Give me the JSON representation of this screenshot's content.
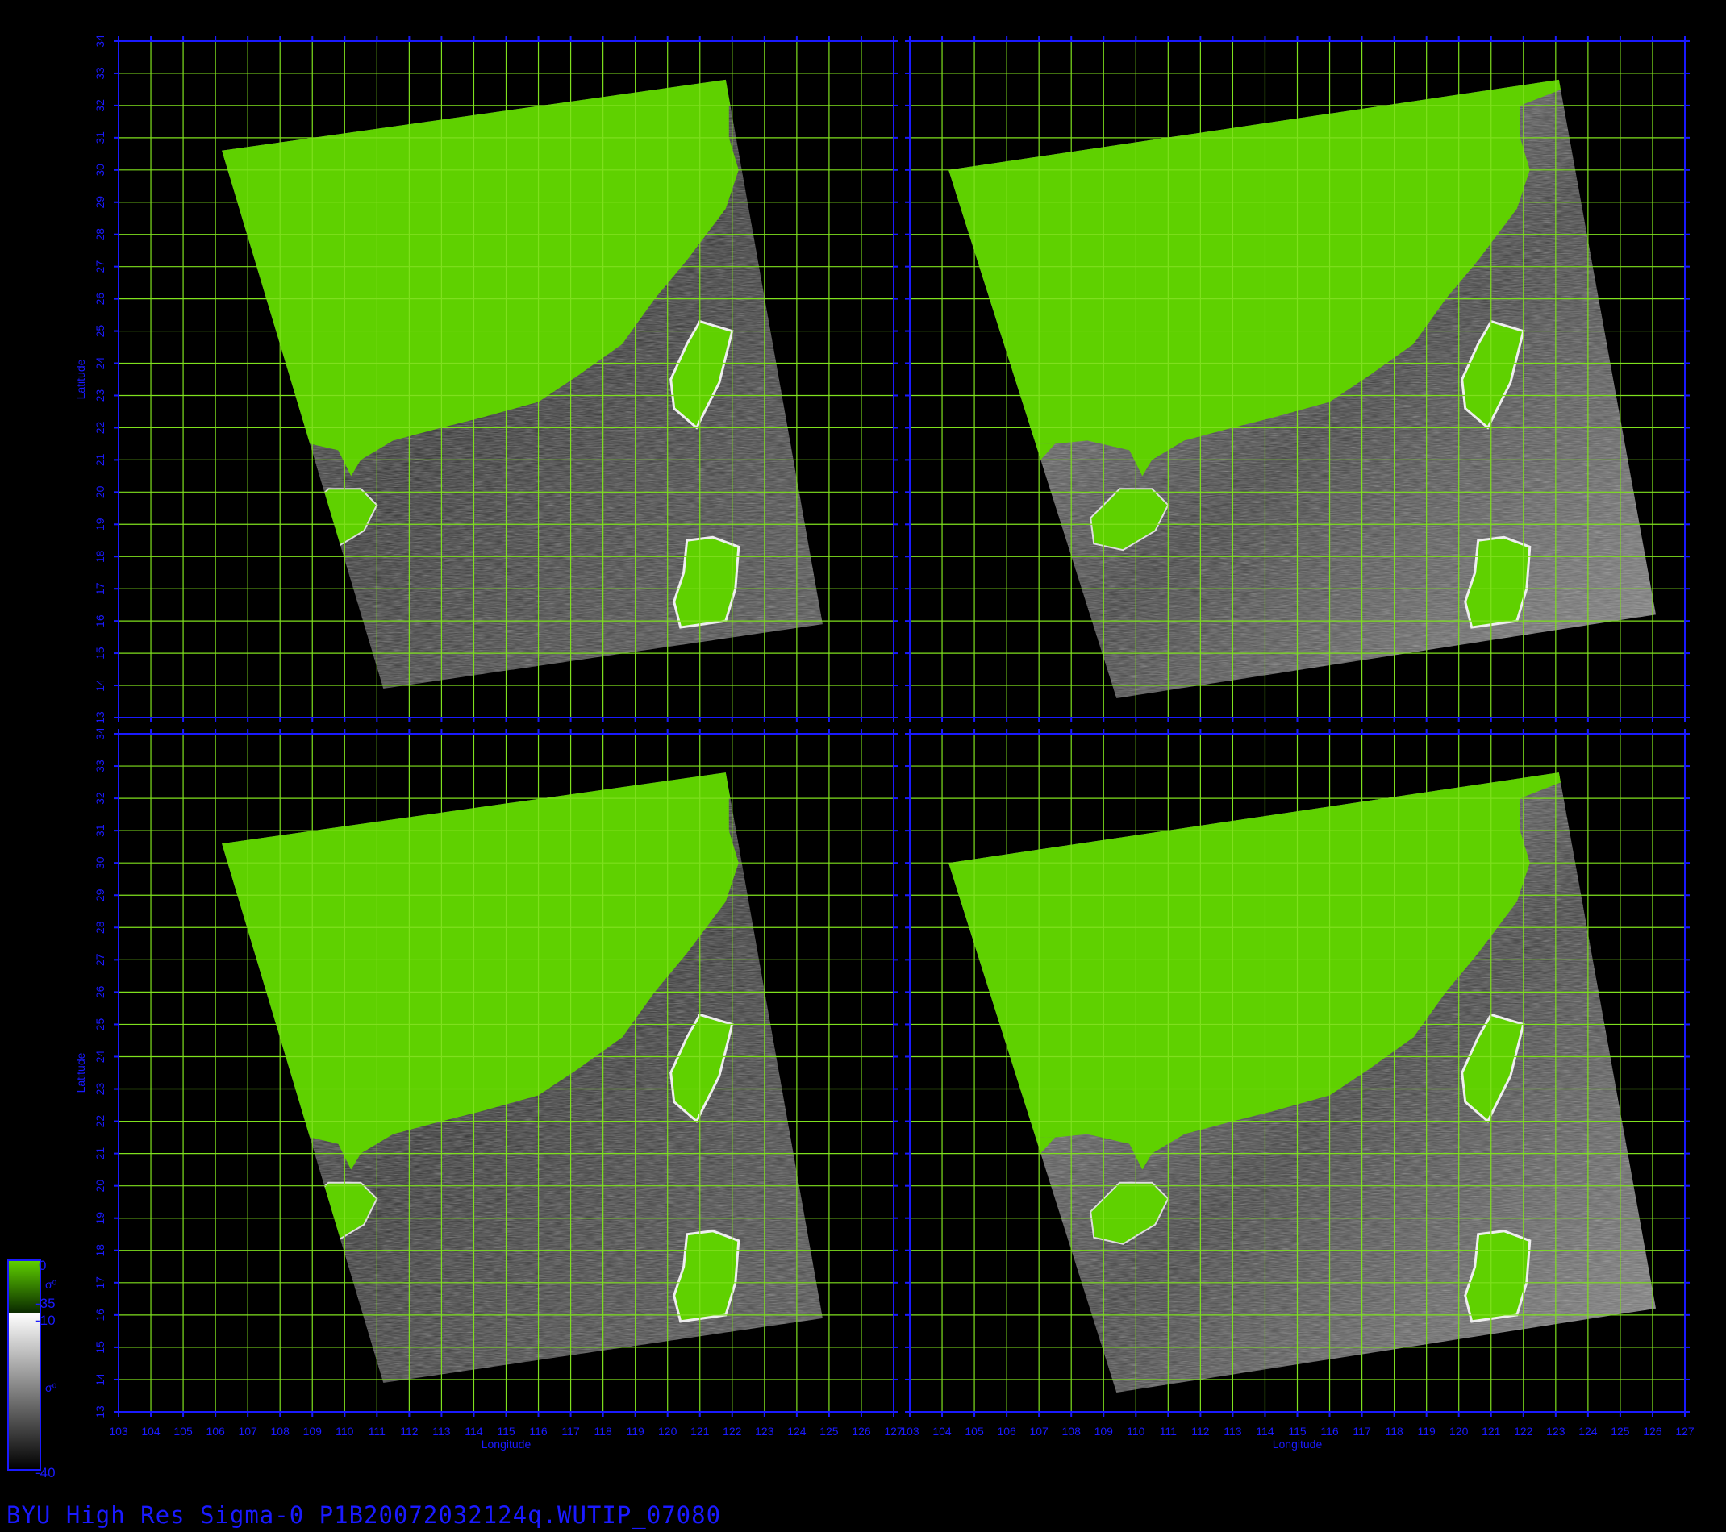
{
  "footer_title": "BYU  High  Res  Sigma-0  P1B20072032124q.WUTIP_07080",
  "axes": {
    "x_label": "Longitude",
    "y_label": "Latitude",
    "x_range": [
      103,
      127
    ],
    "y_range": [
      13,
      34
    ],
    "x_tick_labels": [
      "103",
      "104",
      "105",
      "106",
      "107",
      "108",
      "109",
      "110",
      "111",
      "112",
      "113",
      "114",
      "115",
      "116",
      "117",
      "118",
      "119",
      "120",
      "121",
      "122",
      "123",
      "124",
      "125",
      "126",
      "127"
    ],
    "y_tick_labels": [
      "13",
      "14",
      "15",
      "16",
      "17",
      "18",
      "19",
      "20",
      "21",
      "22",
      "23",
      "24",
      "25",
      "26",
      "27",
      "28",
      "29",
      "30",
      "31",
      "32",
      "33",
      "34"
    ]
  },
  "colorbar": {
    "green_top": "0",
    "green_bottom": "-35",
    "gray_top": "-10",
    "gray_bottom": "-40",
    "symbol": "σ⁰"
  },
  "colors": {
    "frame_blue": "#1a1aff",
    "grid_green": "#7fe01e",
    "land_green": "#5fd100",
    "ocean_dark": "#303030",
    "ocean_light": "#8a8a8a"
  },
  "panels": [
    {
      "id": "upper-left",
      "variant": "a"
    },
    {
      "id": "upper-right",
      "variant": "b"
    },
    {
      "id": "lower-left",
      "variant": "a"
    },
    {
      "id": "lower-right",
      "variant": "b"
    }
  ]
}
